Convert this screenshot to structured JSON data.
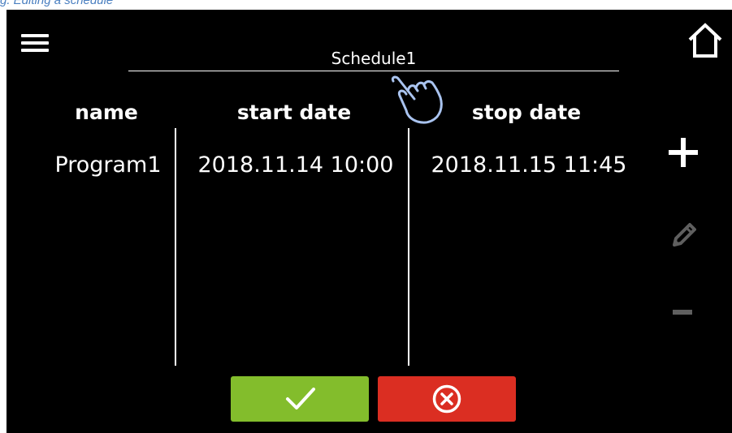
{
  "caption": "g. Editing a schedule",
  "screen": {
    "title": "Schedule1",
    "icons": {
      "menu": "hamburger-menu-icon",
      "home": "home-icon",
      "hand": "tap-hand-icon",
      "add": "plus-icon",
      "edit": "pencil-icon",
      "remove": "minus-icon",
      "confirm": "checkmark-icon",
      "cancel": "cancel-circle-x-icon"
    },
    "table": {
      "headers": [
        "name",
        "start date",
        "stop date"
      ],
      "rows": [
        [
          "Program1",
          "2018.11.14  10:00",
          "2018.11.15  11:45"
        ]
      ]
    },
    "colors": {
      "background": "#000000",
      "confirm": "#83bd2c",
      "cancel": "#db2e22",
      "disabled": "#5f5f5f",
      "hand_outline": "#a9c3ef",
      "caption": "#4a7fc0"
    }
  }
}
